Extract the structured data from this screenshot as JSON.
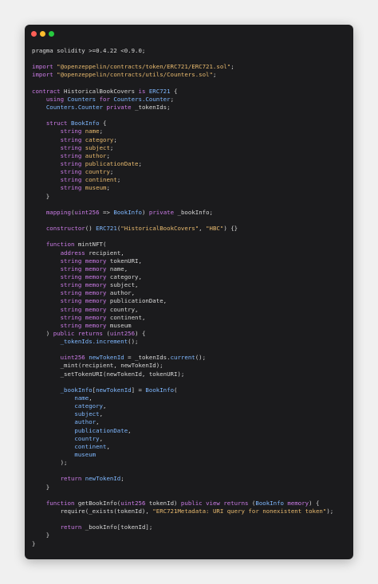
{
  "window": {
    "traffic_lights": {
      "close_color": "#ff5f56",
      "minimize_color": "#ffbd2e",
      "zoom_color": "#27c93f"
    }
  },
  "editor": {
    "language": "solidity",
    "token_colors": {
      "keyword": "#cb7be6",
      "type": "#cb7be6",
      "string": "#e7b96e",
      "class": "#7fb8ff",
      "field": "#e7b96e",
      "plain": "#d7d7d7"
    },
    "lines": [
      [
        [
          "plain",
          "pragma solidity >=0.4.22 <0.9.0;"
        ]
      ],
      [],
      [
        [
          "keyword",
          "import "
        ],
        [
          "string",
          "\"@openzeppelin/contracts/token/ERC721/ERC721.sol\""
        ],
        [
          "plain",
          ";"
        ]
      ],
      [
        [
          "keyword",
          "import "
        ],
        [
          "string",
          "\"@openzeppelin/contracts/utils/Counters.sol\""
        ],
        [
          "plain",
          ";"
        ]
      ],
      [],
      [
        [
          "keyword",
          "contract "
        ],
        [
          "plain",
          "HistoricalBookCovers "
        ],
        [
          "keyword",
          "is "
        ],
        [
          "class",
          "ERC721"
        ],
        [
          "plain",
          " {"
        ]
      ],
      [
        [
          "plain",
          "    "
        ],
        [
          "keyword",
          "using "
        ],
        [
          "class",
          "Counters"
        ],
        [
          "keyword",
          " for "
        ],
        [
          "class",
          "Counters.Counter"
        ],
        [
          "plain",
          ";"
        ]
      ],
      [
        [
          "plain",
          "    "
        ],
        [
          "class",
          "Counters.Counter"
        ],
        [
          "keyword",
          " private "
        ],
        [
          "plain",
          "_tokenIds;"
        ]
      ],
      [],
      [
        [
          "plain",
          "    "
        ],
        [
          "keyword",
          "struct "
        ],
        [
          "class",
          "BookInfo"
        ],
        [
          "plain",
          " {"
        ]
      ],
      [
        [
          "plain",
          "        "
        ],
        [
          "type",
          "string "
        ],
        [
          "field",
          "name"
        ],
        [
          "plain",
          ";"
        ]
      ],
      [
        [
          "plain",
          "        "
        ],
        [
          "type",
          "string "
        ],
        [
          "field",
          "category"
        ],
        [
          "plain",
          ";"
        ]
      ],
      [
        [
          "plain",
          "        "
        ],
        [
          "type",
          "string "
        ],
        [
          "field",
          "subject"
        ],
        [
          "plain",
          ";"
        ]
      ],
      [
        [
          "plain",
          "        "
        ],
        [
          "type",
          "string "
        ],
        [
          "field",
          "author"
        ],
        [
          "plain",
          ";"
        ]
      ],
      [
        [
          "plain",
          "        "
        ],
        [
          "type",
          "string "
        ],
        [
          "field",
          "publicationDate"
        ],
        [
          "plain",
          ";"
        ]
      ],
      [
        [
          "plain",
          "        "
        ],
        [
          "type",
          "string "
        ],
        [
          "field",
          "country"
        ],
        [
          "plain",
          ";"
        ]
      ],
      [
        [
          "plain",
          "        "
        ],
        [
          "type",
          "string "
        ],
        [
          "field",
          "continent"
        ],
        [
          "plain",
          ";"
        ]
      ],
      [
        [
          "plain",
          "        "
        ],
        [
          "type",
          "string "
        ],
        [
          "field",
          "museum"
        ],
        [
          "plain",
          ";"
        ]
      ],
      [
        [
          "plain",
          "    }"
        ]
      ],
      [],
      [
        [
          "plain",
          "    "
        ],
        [
          "keyword",
          "mapping"
        ],
        [
          "plain",
          "("
        ],
        [
          "type",
          "uint256"
        ],
        [
          "plain",
          " => "
        ],
        [
          "class",
          "BookInfo"
        ],
        [
          "plain",
          ") "
        ],
        [
          "keyword",
          "private "
        ],
        [
          "plain",
          "_bookInfo;"
        ]
      ],
      [],
      [
        [
          "plain",
          "    "
        ],
        [
          "keyword",
          "constructor"
        ],
        [
          "plain",
          "() "
        ],
        [
          "class",
          "ERC721"
        ],
        [
          "plain",
          "("
        ],
        [
          "string",
          "\"HistoricalBookCovers\""
        ],
        [
          "plain",
          ", "
        ],
        [
          "string",
          "\"HBC\""
        ],
        [
          "plain",
          ") {}"
        ]
      ],
      [],
      [
        [
          "plain",
          "    "
        ],
        [
          "keyword",
          "function "
        ],
        [
          "fn",
          "mintNFT("
        ]
      ],
      [
        [
          "plain",
          "        "
        ],
        [
          "type",
          "address "
        ],
        [
          "plain",
          "recipient,"
        ]
      ],
      [
        [
          "plain",
          "        "
        ],
        [
          "type",
          "string memory "
        ],
        [
          "plain",
          "tokenURI,"
        ]
      ],
      [
        [
          "plain",
          "        "
        ],
        [
          "type",
          "string memory "
        ],
        [
          "plain",
          "name,"
        ]
      ],
      [
        [
          "plain",
          "        "
        ],
        [
          "type",
          "string memory "
        ],
        [
          "plain",
          "category,"
        ]
      ],
      [
        [
          "plain",
          "        "
        ],
        [
          "type",
          "string memory "
        ],
        [
          "plain",
          "subject,"
        ]
      ],
      [
        [
          "plain",
          "        "
        ],
        [
          "type",
          "string memory "
        ],
        [
          "plain",
          "author,"
        ]
      ],
      [
        [
          "plain",
          "        "
        ],
        [
          "type",
          "string memory "
        ],
        [
          "plain",
          "publicationDate,"
        ]
      ],
      [
        [
          "plain",
          "        "
        ],
        [
          "type",
          "string memory "
        ],
        [
          "plain",
          "country,"
        ]
      ],
      [
        [
          "plain",
          "        "
        ],
        [
          "type",
          "string memory "
        ],
        [
          "plain",
          "continent,"
        ]
      ],
      [
        [
          "plain",
          "        "
        ],
        [
          "type",
          "string memory "
        ],
        [
          "plain",
          "museum"
        ]
      ],
      [
        [
          "plain",
          "    ) "
        ],
        [
          "keyword",
          "public returns "
        ],
        [
          "plain",
          "("
        ],
        [
          "type",
          "uint256"
        ],
        [
          "plain",
          ") {"
        ]
      ],
      [
        [
          "plain",
          "        "
        ],
        [
          "class",
          "_tokenIds.increment"
        ],
        [
          "plain",
          "();"
        ]
      ],
      [],
      [
        [
          "plain",
          "        "
        ],
        [
          "type",
          "uint256 "
        ],
        [
          "class",
          "newTokenId"
        ],
        [
          "plain",
          " = _tokenIds."
        ],
        [
          "class",
          "current"
        ],
        [
          "plain",
          "();"
        ]
      ],
      [
        [
          "plain",
          "        _mint(recipient, newTokenId);"
        ]
      ],
      [
        [
          "plain",
          "        _setTokenURI(newTokenId, tokenURI);"
        ]
      ],
      [],
      [
        [
          "plain",
          "        "
        ],
        [
          "class",
          "_bookInfo"
        ],
        [
          "plain",
          "["
        ],
        [
          "class",
          "newTokenId"
        ],
        [
          "plain",
          "] = "
        ],
        [
          "class",
          "BookInfo"
        ],
        [
          "plain",
          "("
        ]
      ],
      [
        [
          "plain",
          "            "
        ],
        [
          "class",
          "name"
        ],
        [
          "plain",
          ","
        ]
      ],
      [
        [
          "plain",
          "            "
        ],
        [
          "class",
          "category"
        ],
        [
          "plain",
          ","
        ]
      ],
      [
        [
          "plain",
          "            "
        ],
        [
          "class",
          "subject"
        ],
        [
          "plain",
          ","
        ]
      ],
      [
        [
          "plain",
          "            "
        ],
        [
          "class",
          "author"
        ],
        [
          "plain",
          ","
        ]
      ],
      [
        [
          "plain",
          "            "
        ],
        [
          "class",
          "publicationDate"
        ],
        [
          "plain",
          ","
        ]
      ],
      [
        [
          "plain",
          "            "
        ],
        [
          "class",
          "country"
        ],
        [
          "plain",
          ","
        ]
      ],
      [
        [
          "plain",
          "            "
        ],
        [
          "class",
          "continent"
        ],
        [
          "plain",
          ","
        ]
      ],
      [
        [
          "plain",
          "            "
        ],
        [
          "class",
          "museum"
        ]
      ],
      [
        [
          "plain",
          "        );"
        ]
      ],
      [],
      [
        [
          "plain",
          "        "
        ],
        [
          "keyword",
          "return "
        ],
        [
          "class",
          "newTokenId"
        ],
        [
          "plain",
          ";"
        ]
      ],
      [
        [
          "plain",
          "    }"
        ]
      ],
      [],
      [
        [
          "plain",
          "    "
        ],
        [
          "keyword",
          "function "
        ],
        [
          "plain",
          "getBookInfo("
        ],
        [
          "type",
          "uint256"
        ],
        [
          "plain",
          " tokenId) "
        ],
        [
          "keyword",
          "public view returns "
        ],
        [
          "plain",
          "("
        ],
        [
          "class",
          "BookInfo"
        ],
        [
          "keyword",
          " memory"
        ],
        [
          "plain",
          ") {"
        ]
      ],
      [
        [
          "plain",
          "        require(_exists(tokenId), "
        ],
        [
          "string",
          "\"ERC721Metadata: URI query for nonexistent token\""
        ],
        [
          "plain",
          ");"
        ]
      ],
      [],
      [
        [
          "plain",
          "        "
        ],
        [
          "keyword",
          "return "
        ],
        [
          "plain",
          "_bookInfo[tokenId];"
        ]
      ],
      [
        [
          "plain",
          "    }"
        ]
      ],
      [
        [
          "plain",
          "}"
        ]
      ]
    ]
  }
}
